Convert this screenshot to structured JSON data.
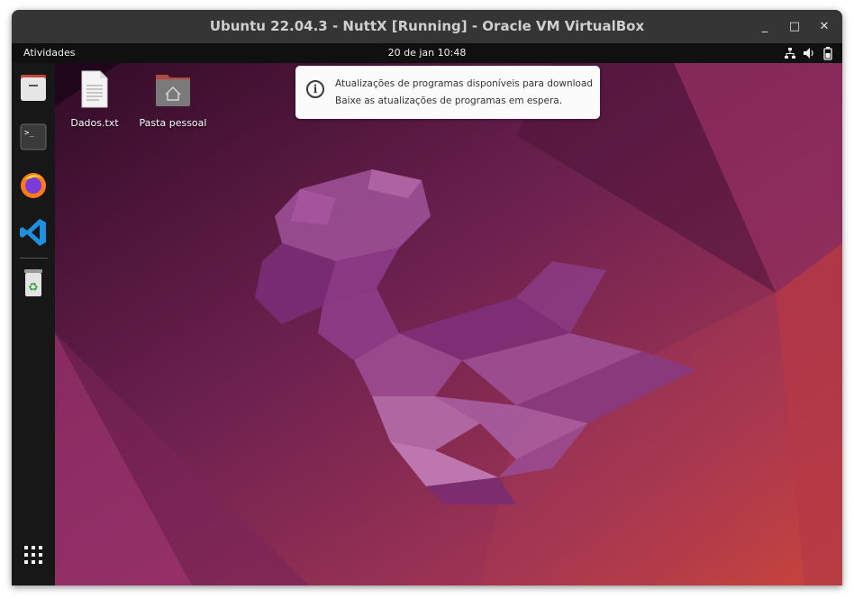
{
  "window": {
    "title": "Ubuntu 22.04.3 - NuttX [Running] - Oracle VM VirtualBox",
    "minimize_glyph": "_",
    "maximize_glyph": "□",
    "close_glyph": "✕"
  },
  "topbar": {
    "activities": "Atividades",
    "clock": "20 de jan  10:48",
    "tray": [
      "network-icon",
      "volume-icon",
      "battery-icon"
    ]
  },
  "dock": {
    "items": [
      "files-icon",
      "terminal-icon",
      "firefox-icon",
      "vscode-icon",
      "trash-icon"
    ],
    "apps_grid": "show-apps-icon"
  },
  "desktop": {
    "icons": [
      {
        "label": "Dados.txt",
        "icon": "text-file-icon"
      },
      {
        "label": "Pasta pessoal",
        "icon": "home-folder-icon"
      }
    ]
  },
  "notification": {
    "line1": "Atualizações de programas disponíveis para download",
    "line2": "Baixe as atualizações de programas em espera.",
    "icon": "info-icon",
    "icon_glyph": "i"
  },
  "colors": {
    "wallpaper_dark": "#3b0c2e",
    "wallpaper_mid": "#7d2a5b",
    "wallpaper_light": "#c4453f",
    "jellyfish": "#8e3a86"
  }
}
